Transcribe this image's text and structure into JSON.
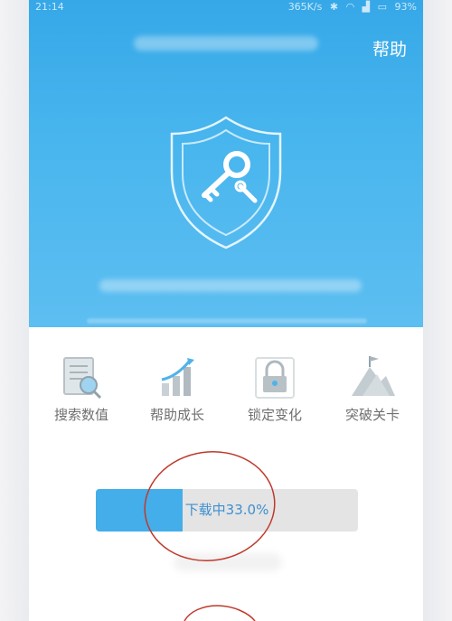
{
  "status_bar": {
    "time": "21:14",
    "speed": "365K/s",
    "battery": "93%",
    "icons": [
      "bluetooth-icon",
      "wifi-icon",
      "signal-icon",
      "battery-icon"
    ]
  },
  "header": {
    "help_label": "帮助"
  },
  "features": [
    {
      "label": "搜索数值",
      "icon": "search-document-icon"
    },
    {
      "label": "帮助成长",
      "icon": "growth-chart-icon"
    },
    {
      "label": "锁定变化",
      "icon": "lock-icon"
    },
    {
      "label": "突破关卡",
      "icon": "mountain-flag-icon"
    }
  ],
  "download": {
    "text": "下载中33.0%",
    "progress": 0.33
  },
  "colors": {
    "accent": "#43aee9",
    "hero_top": "#36a8e8",
    "annotation": "#c0392b"
  }
}
